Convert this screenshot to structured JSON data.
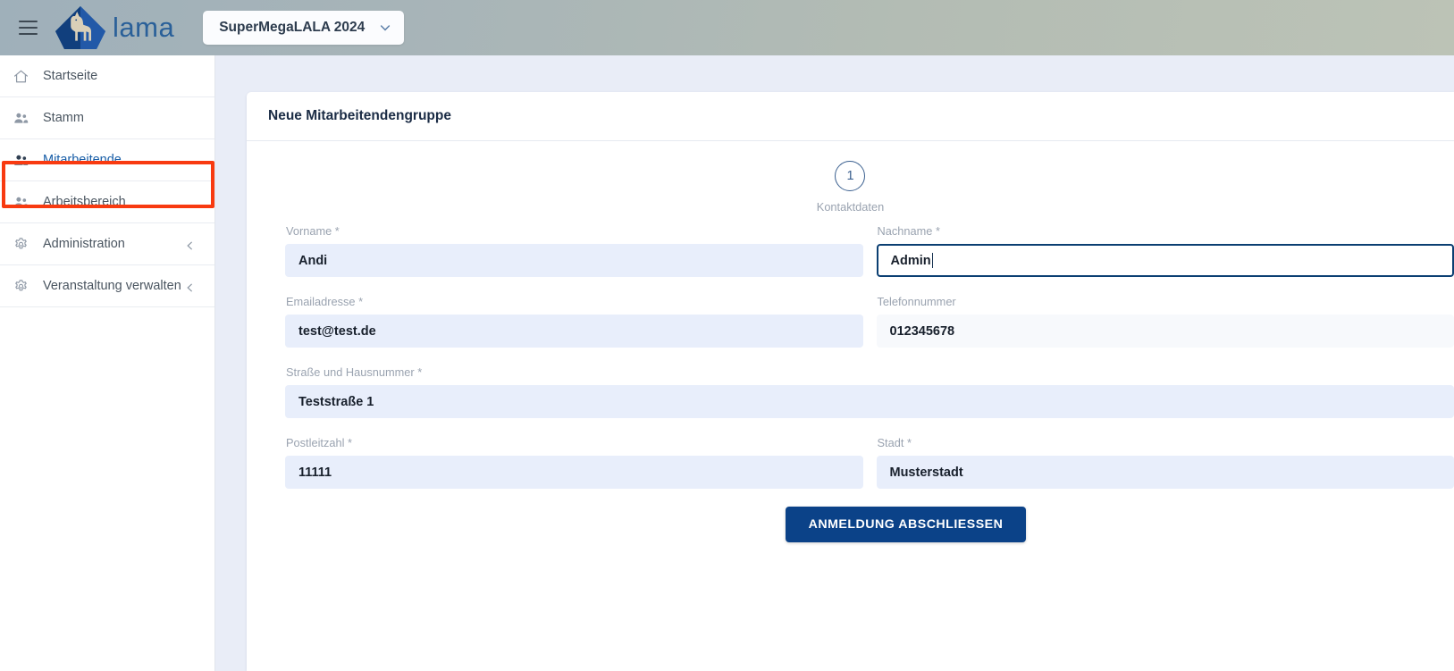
{
  "header": {
    "menu_icon": "hamburger-menu-icon",
    "logo_icon": "lama-llama-logo-icon",
    "brand": "lama",
    "project_selector": {
      "value": "SuperMegaLALA 2024",
      "chevron_icon": "chevron-down-icon"
    }
  },
  "sidebar": {
    "items": [
      {
        "label": "Startseite",
        "icon": "home-icon",
        "active": false,
        "expandable": false
      },
      {
        "label": "Stamm",
        "icon": "people-icon",
        "active": false,
        "expandable": false
      },
      {
        "label": "Mitarbeitende",
        "icon": "people-icon",
        "active": true,
        "expandable": false
      },
      {
        "label": "Arbeitsbereich",
        "icon": "people-icon",
        "active": false,
        "expandable": false
      },
      {
        "label": "Administration",
        "icon": "gear-icon",
        "active": false,
        "expandable": true
      },
      {
        "label": "Veranstaltung verwalten",
        "icon": "gear-icon",
        "active": false,
        "expandable": true
      }
    ],
    "highlight_color": "#f83a10",
    "active_color": "#1a5fa8"
  },
  "card": {
    "title": "Neue Mitarbeitendengruppe"
  },
  "stepper": {
    "steps": [
      {
        "number": "1",
        "label": "Kontaktdaten"
      }
    ]
  },
  "form": {
    "rows": [
      {
        "fields": [
          {
            "label": "Vorname",
            "required_marker": "*",
            "value": "Andi",
            "state": "filled"
          },
          {
            "label": "Nachname",
            "required_marker": "*",
            "value": "Admin",
            "state": "focused"
          }
        ]
      },
      {
        "fields": [
          {
            "label": "Emailadresse",
            "required_marker": "*",
            "value": "test@test.de",
            "state": "filled"
          },
          {
            "label": "Telefonnummer",
            "required_marker": "",
            "value": "012345678",
            "state": "plain"
          }
        ]
      },
      {
        "fields": [
          {
            "label": "Straße und Hausnummer",
            "required_marker": "*",
            "value": "Teststraße 1",
            "state": "filled"
          }
        ]
      },
      {
        "fields": [
          {
            "label": "Postleitzahl",
            "required_marker": "*",
            "value": "11111",
            "state": "filled"
          },
          {
            "label": "Stadt",
            "required_marker": "*",
            "value": "Musterstadt",
            "state": "filled"
          }
        ]
      }
    ],
    "submit_label": "ANMELDUNG ABSCHLIESSEN"
  },
  "colors": {
    "brand_blue": "#2a6099",
    "button_blue": "#0b4288",
    "focus_border": "#0b3f72",
    "filled_bg": "#e8eefb",
    "page_bg": "#e9edf7",
    "highlight_red": "#f83a10"
  }
}
